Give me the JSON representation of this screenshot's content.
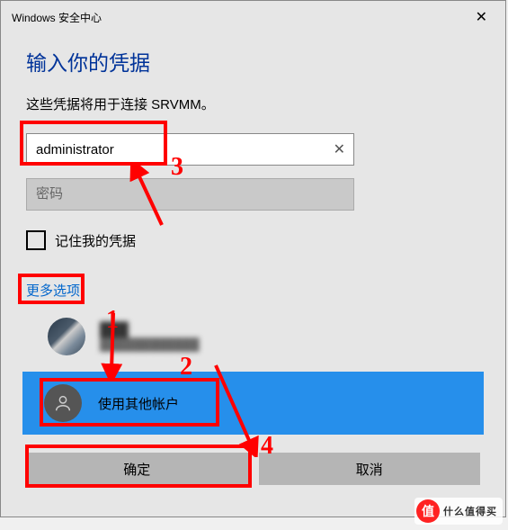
{
  "titlebar": {
    "title": "Windows 安全中心"
  },
  "heading": "输入你的凭据",
  "subtitle": "这些凭据将用于连接 SRVMM。",
  "username": {
    "value": "administrator",
    "clear_icon": "✕"
  },
  "password": {
    "placeholder": "密码"
  },
  "remember": {
    "label": "记住我的凭据"
  },
  "more_options": "更多选项",
  "account": {
    "name": "███",
    "email": "████████████"
  },
  "other_account": {
    "label": "使用其他帐户"
  },
  "buttons": {
    "ok": "确定",
    "cancel": "取消"
  },
  "annotations": {
    "n1": "1",
    "n2": "2",
    "n3": "3",
    "n4": "4"
  },
  "watermark": {
    "logo": "值",
    "text": "什么值得买"
  }
}
